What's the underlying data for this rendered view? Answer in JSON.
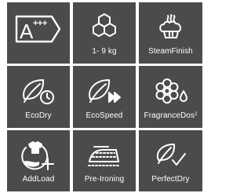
{
  "tiles": [
    {
      "icon": "energy-class-a-plus-plus-plus-icon",
      "label": ""
    },
    {
      "icon": "hexagon-cluster-load-icon",
      "label": "1- 9 kg"
    },
    {
      "icon": "steam-finish-icon",
      "label": "SteamFinish"
    },
    {
      "icon": "eco-leaf-clock-icon",
      "label": "EcoDry"
    },
    {
      "icon": "eco-leaf-fast-forward-icon",
      "label": "EcoSpeed"
    },
    {
      "icon": "fragrance-flower-drop-icon",
      "label": "FragranceDos",
      "label_sup": "2"
    },
    {
      "icon": "add-load-shirt-plus-icon",
      "label": "AddLoad"
    },
    {
      "icon": "pre-ironing-iron-icon",
      "label": "Pre-Ironing"
    },
    {
      "icon": "perfect-dry-leaf-check-icon",
      "label": "PerfectDry"
    }
  ],
  "energy_badge": {
    "letter": "A",
    "plus": "+++"
  },
  "colors": {
    "tile_background": "#4b4b4b",
    "foreground": "#ffffff",
    "page_background": "#ffffff"
  }
}
